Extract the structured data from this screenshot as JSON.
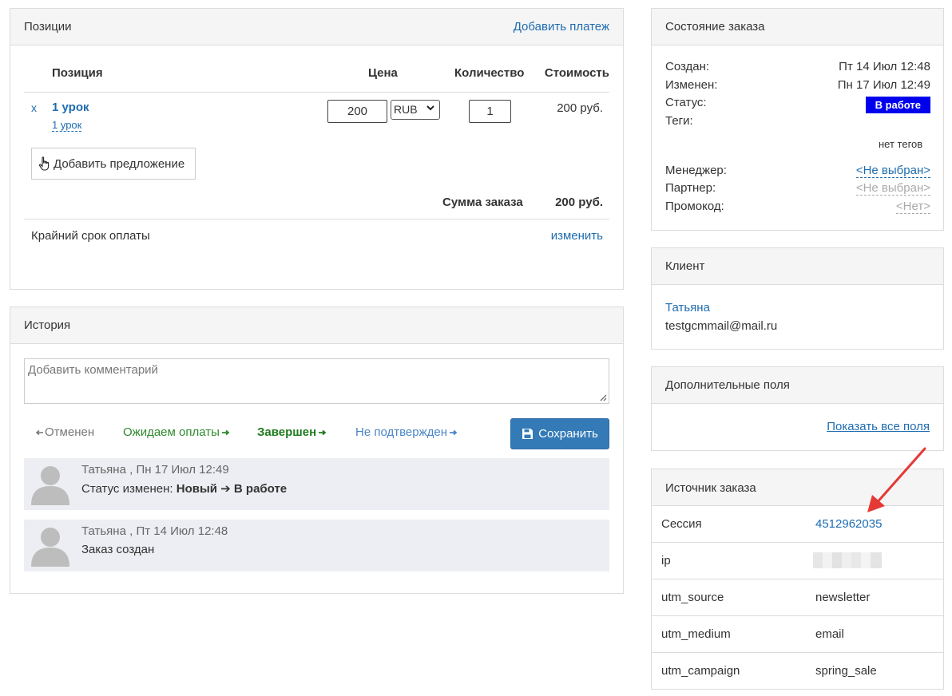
{
  "positions": {
    "title": "Позиции",
    "add_payment": "Добавить платеж",
    "columns": {
      "position": "Позиция",
      "price": "Цена",
      "quantity": "Количество",
      "cost": "Стоимость"
    },
    "items": [
      {
        "remove": "x",
        "name": "1 урок",
        "sub": "1 урок",
        "price": "200",
        "currency": "RUB",
        "quantity": "1",
        "cost": "200 руб."
      }
    ],
    "add_offer": "Добавить предложение",
    "sum_label": "Сумма заказа",
    "sum_value": "200 руб.",
    "deadline_label": "Крайний срок оплаты",
    "deadline_link": "изменить"
  },
  "history": {
    "title": "История",
    "comment_placeholder": "Добавить комментарий",
    "statuses": {
      "cancelled": "Отменен",
      "awaiting": "Ожидаем оплаты",
      "done": "Завершен",
      "unconfirmed": "Не подтвержден"
    },
    "save": "Сохранить",
    "entries": [
      {
        "meta": "Татьяна , Пн 17 Июл 12:49",
        "prefix": "Статус изменен: ",
        "from": "Новый",
        "to": "В работе"
      },
      {
        "meta": "Татьяна , Пт 14 Июл 12:48",
        "text": "Заказ создан"
      }
    ]
  },
  "order_status": {
    "title": "Состояние заказа",
    "created_label": "Создан:",
    "created_value": "Пт 14 Июл 12:48",
    "modified_label": "Изменен:",
    "modified_value": "Пн 17 Июл 12:49",
    "status_label": "Статус:",
    "status_value": "В работе",
    "tags_label": "Теги:",
    "tags_value": "нет тегов",
    "manager_label": "Менеджер:",
    "manager_value": "<Не выбран>",
    "partner_label": "Партнер:",
    "partner_value": "<Не выбран>",
    "promo_label": "Промокод:",
    "promo_value": "<Нет>"
  },
  "client": {
    "title": "Клиент",
    "name": "Татьяна",
    "email": "testgcmmail@mail.ru"
  },
  "extra_fields": {
    "title": "Дополнительные поля",
    "show_all": "Показать все поля"
  },
  "source": {
    "title": "Источник заказа",
    "rows": [
      {
        "key": "Сессия",
        "value": "4512962035"
      },
      {
        "key": "ip",
        "value": ""
      },
      {
        "key": "utm_source",
        "value": "newsletter"
      },
      {
        "key": "utm_medium",
        "value": "email"
      },
      {
        "key": "utm_campaign",
        "value": "spring_sale"
      }
    ]
  },
  "colors": {
    "link": "#1f6cb0",
    "status_badge": "#0000ee",
    "save_button": "#337ab7",
    "arrow": "#e53935"
  }
}
